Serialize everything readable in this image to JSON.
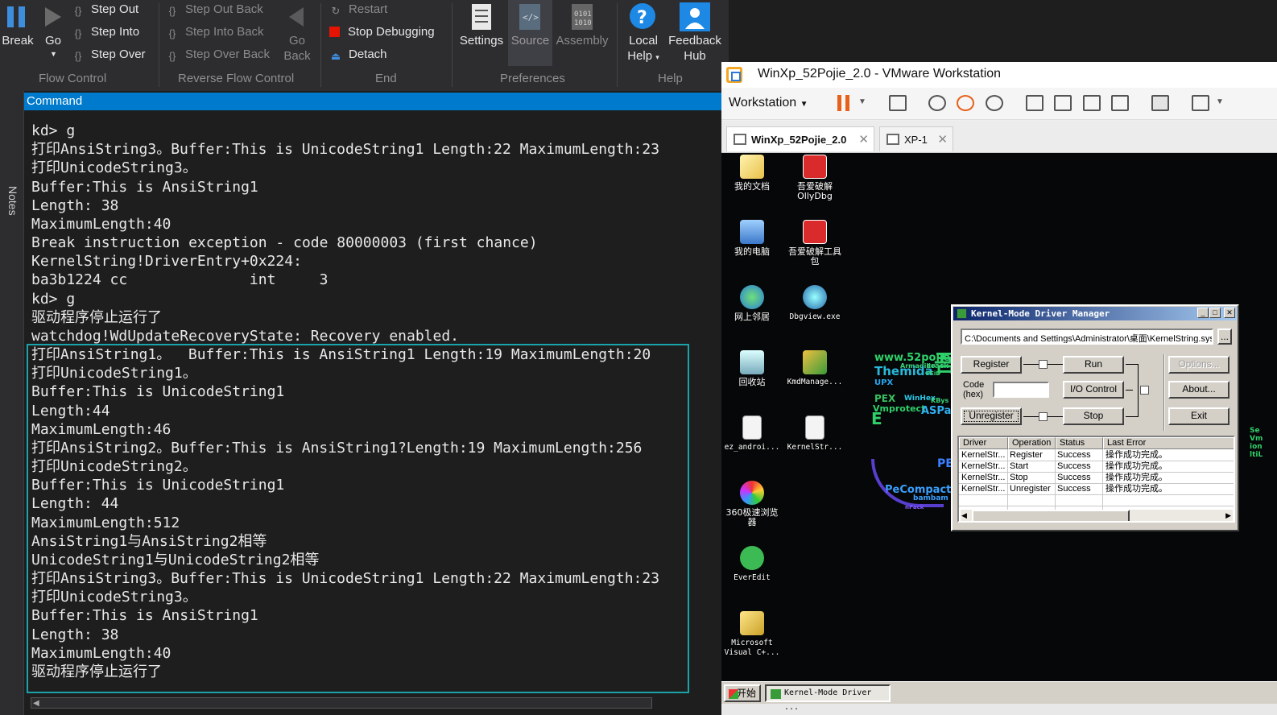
{
  "windbg": {
    "ribbon": {
      "break_label": "Break",
      "go_label": "Go",
      "step_out": "Step Out",
      "step_into": "Step Into",
      "step_over": "Step Over",
      "step_out_back": "Step Out Back",
      "step_into_back": "Step Into Back",
      "step_over_back": "Step Over Back",
      "go_back_line1": "Go",
      "go_back_line2": "Back",
      "restart": "Restart",
      "stop_debugging": "Stop Debugging",
      "detach": "Detach",
      "settings": "Settings",
      "source": "Source",
      "assembly": "Assembly",
      "local_help_line1": "Local",
      "local_help_line2": "Help",
      "feedback_line1": "Feedback",
      "feedback_line2": "Hub",
      "groups": {
        "flow_control": "Flow Control",
        "reverse_flow_control": "Reverse Flow Control",
        "end": "End",
        "preferences": "Preferences",
        "help": "Help"
      }
    },
    "notes_label": "Notes",
    "command_title": "Command",
    "command_lines": [
      "kd> g",
      "打印AnsiString3。Buffer:This is UnicodeString1 Length:22 MaximumLength:23",
      "打印UnicodeString3。",
      "Buffer:This is AnsiString1",
      "Length: 38",
      "MaximumLength:40",
      "Break instruction exception - code 80000003 (first chance)",
      "KernelString!DriverEntry+0x224:",
      "ba3b1224 cc              int     3",
      "kd> g",
      "驱动程序停止运行了",
      "watchdog!WdUpdateRecoveryState: Recovery enabled.",
      "打印AnsiString1。  Buffer:This is AnsiString1 Length:19 MaximumLength:20",
      "打印UnicodeString1。",
      "Buffer:This is UnicodeString1",
      "Length:44",
      "MaximumLength:46",
      "打印AnsiString2。Buffer:This is AnsiString1?Length:19 MaximumLength:256",
      "打印UnicodeString2。",
      "Buffer:This is UnicodeString1",
      "Length: 44",
      "MaximumLength:512",
      "AnsiString1与AnsiString2相等",
      "UnicodeString1与UnicodeString2相等",
      "打印AnsiString3。Buffer:This is UnicodeString1 Length:22 MaximumLength:23",
      "打印UnicodeString3。",
      "Buffer:This is AnsiString1",
      "Length: 38",
      "MaximumLength:40",
      "驱动程序停止运行了"
    ]
  },
  "vmware": {
    "title": "WinXp_52Pojie_2.0 - VMware Workstation",
    "workstation_menu": "Workstation",
    "tabs": [
      "WinXp_52Pojie_2.0",
      "XP-1"
    ],
    "accent_color": "#f5a623"
  },
  "desktop": {
    "icons": [
      {
        "label": "我的文档",
        "icon": "my-documents-icon"
      },
      {
        "label": "吾爱破解\nOllyDbg",
        "icon": "ollydbg-icon"
      },
      {
        "label": "我的电脑",
        "icon": "my-computer-icon"
      },
      {
        "label": "吾爱破解工具\n包",
        "icon": "toolkit-icon"
      },
      {
        "label": "网上邻居",
        "icon": "network-icon"
      },
      {
        "label": "Dbgview.exe",
        "icon": "dbgview-icon"
      },
      {
        "label": "回收站",
        "icon": "recycle-bin-icon"
      },
      {
        "label": "KmdManage...",
        "icon": "kmdmanager-icon"
      },
      {
        "label": "ez_androi...",
        "icon": "file-icon"
      },
      {
        "label": "KernelStr...",
        "icon": "file-icon"
      },
      {
        "label": "360极速浏览\n器",
        "icon": "browser-360-icon"
      },
      {
        "label": "EverEdit",
        "icon": "everedit-icon"
      },
      {
        "label": "Microsoft\nVisual C+...",
        "icon": "visual-cpp-icon"
      }
    ],
    "wallpaper_text": [
      "www.52pojie.cn",
      "Themida",
      "UPX",
      "PEX",
      "WinHex",
      "Vmprotect",
      "ASPack",
      "PeCompact",
      "bambam",
      "Armadillo",
      "crack",
      "PEiD",
      "nPack",
      "KBys"
    ]
  },
  "kmd": {
    "title": "Kernel-Mode Driver Manager",
    "path": "C:\\Documents and Settings\\Administrator\\桌面\\KernelString.sys",
    "browse": "...",
    "buttons": {
      "register": "Register",
      "run": "Run",
      "io_control": "I/O Control",
      "unregister": "Unregister",
      "stop": "Stop",
      "options": "Options...",
      "about": "About...",
      "exit": "Exit"
    },
    "code_label_line1": "Code",
    "code_label_line2": "(hex)",
    "columns": [
      "Driver",
      "Operation",
      "Status",
      "Last Error"
    ],
    "rows": [
      [
        "KernelStr...",
        "Register",
        "Success",
        "操作成功完成。"
      ],
      [
        "KernelStr...",
        "Start",
        "Success",
        "操作成功完成。"
      ],
      [
        "KernelStr...",
        "Stop",
        "Success",
        "操作成功完成。"
      ],
      [
        "KernelStr...",
        "Unregister",
        "Success",
        "操作成功完成。"
      ]
    ]
  },
  "taskbar": {
    "start": "开始",
    "task_kmd": "Kernel-Mode Driver ..."
  }
}
